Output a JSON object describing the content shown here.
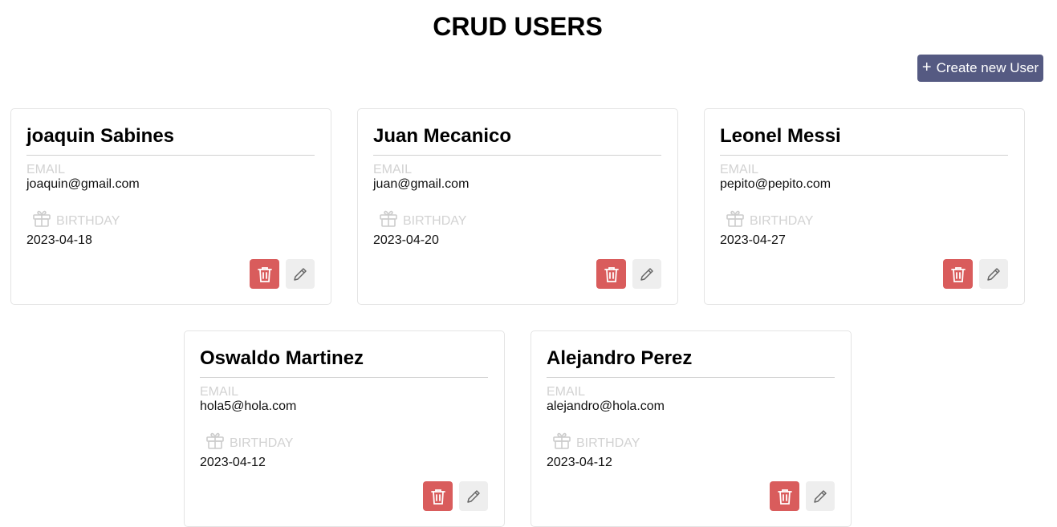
{
  "header": {
    "title": "CRUD USERS",
    "create_button": {
      "icon": "plus-icon",
      "label": "Create new User"
    }
  },
  "colors": {
    "primary_button": "#555a82",
    "delete_button": "#d95c5c",
    "edit_button": "#eeeeee",
    "muted_label": "#d2d2d2"
  },
  "users": [
    {
      "name": "joaquin Sabines",
      "email_label": "EMAIL",
      "email": "joaquin@gmail.com",
      "birthday_label": "BIRTHDAY",
      "birthday": "2023-04-18"
    },
    {
      "name": "Juan Mecanico",
      "email_label": "EMAIL",
      "email": "juan@gmail.com",
      "birthday_label": "BIRTHDAY",
      "birthday": "2023-04-20"
    },
    {
      "name": "Leonel Messi",
      "email_label": "EMAIL",
      "email": "pepito@pepito.com",
      "birthday_label": "BIRTHDAY",
      "birthday": "2023-04-27"
    },
    {
      "name": "Oswaldo Martinez",
      "email_label": "EMAIL",
      "email": "hola5@hola.com",
      "birthday_label": "BIRTHDAY",
      "birthday": "2023-04-12"
    },
    {
      "name": "Alejandro Perez",
      "email_label": "EMAIL",
      "email": "alejandro@hola.com",
      "birthday_label": "BIRTHDAY",
      "birthday": "2023-04-12"
    }
  ],
  "card_icons": {
    "birthday": "gift-icon",
    "delete": "trash-icon",
    "edit": "pencil-icon"
  }
}
